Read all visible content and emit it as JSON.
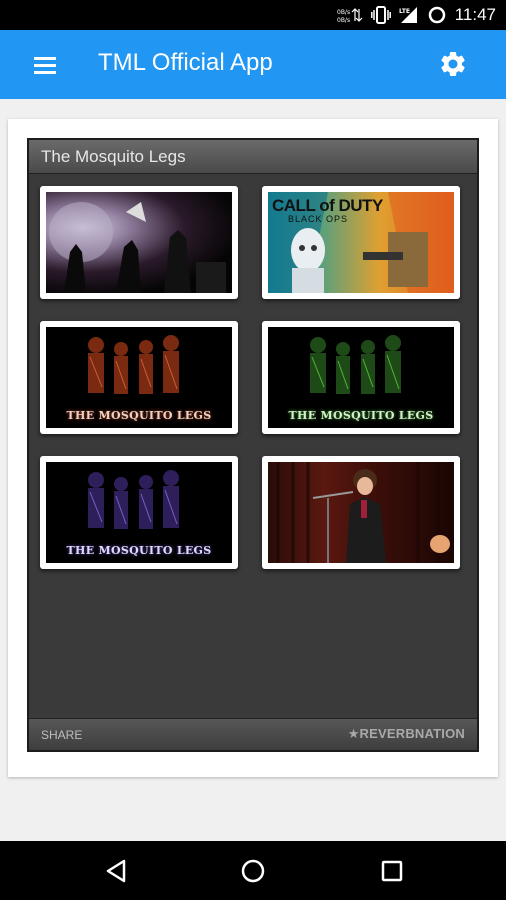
{
  "status_bar": {
    "time": "11:47",
    "icons": [
      "data-transfer-icon",
      "vibrate-icon",
      "lte-signal-icon",
      "battery-icon"
    ],
    "network_label": "LTE"
  },
  "app_bar": {
    "title": "TML Official App",
    "menu_icon": "hamburger-menu-icon",
    "settings_icon": "gear-icon",
    "color": "#2196f3"
  },
  "widget": {
    "title": "The Mosquito Legs",
    "thumbnails": [
      {
        "subject": "concert-stage-photo"
      },
      {
        "subject": "call-of-duty-black-ops-art",
        "text": "CALL of DUTY",
        "subtext": "BLACK OPS"
      },
      {
        "subject": "band-photo-red",
        "text": "THE MOSQUITO LEGS"
      },
      {
        "subject": "band-photo-green",
        "text": "THE MOSQUITO LEGS"
      },
      {
        "subject": "band-photo-purple",
        "text": "THE MOSQUITO LEGS"
      },
      {
        "subject": "singer-on-stage-photo"
      }
    ],
    "footer": {
      "share_label": "SHARE",
      "brand_label": "REVERBNATION",
      "brand_icon": "star-icon"
    }
  },
  "nav_bar": {
    "back_icon": "back-triangle-icon",
    "home_icon": "home-circle-icon",
    "recents_icon": "recents-square-icon"
  }
}
